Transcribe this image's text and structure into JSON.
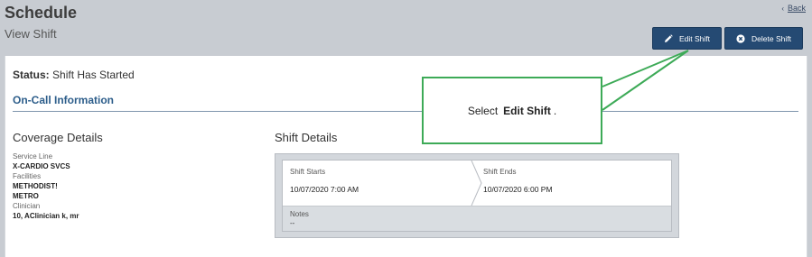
{
  "header": {
    "title": "Schedule",
    "subtitle": "View Shift",
    "back_label": "Back",
    "back_chevron": "‹"
  },
  "actions": {
    "edit_label": "Edit Shift",
    "delete_label": "Delete Shift",
    "edit_icon": "pencil-icon",
    "delete_icon": "close-circle-icon"
  },
  "status": {
    "label": "Status:",
    "value": "Shift Has Started"
  },
  "section": {
    "title": "On-Call Information"
  },
  "coverage": {
    "title": "Coverage Details",
    "service_line_label": "Service Line",
    "service_line_value": "X-CARDIO SVCS",
    "facilities_label": "Facilities",
    "facilities_value_1": "METHODIST!",
    "facilities_value_2": "METRO",
    "clinician_label": "Clinician",
    "clinician_value": "10, AClinician k, mr"
  },
  "shift": {
    "title": "Shift Details",
    "starts_label": "Shift Starts",
    "starts_value": "10/07/2020 7:00 AM",
    "ends_label": "Shift Ends",
    "ends_value": "10/07/2020 6:00 PM",
    "notes_label": "Notes",
    "notes_value": "--"
  },
  "callout": {
    "prefix": "Select",
    "bold": "Edit Shift",
    "suffix": "."
  },
  "colors": {
    "primary_button": "#254a73",
    "callout_border": "#3daa57",
    "section_title": "#2c5d8a"
  }
}
